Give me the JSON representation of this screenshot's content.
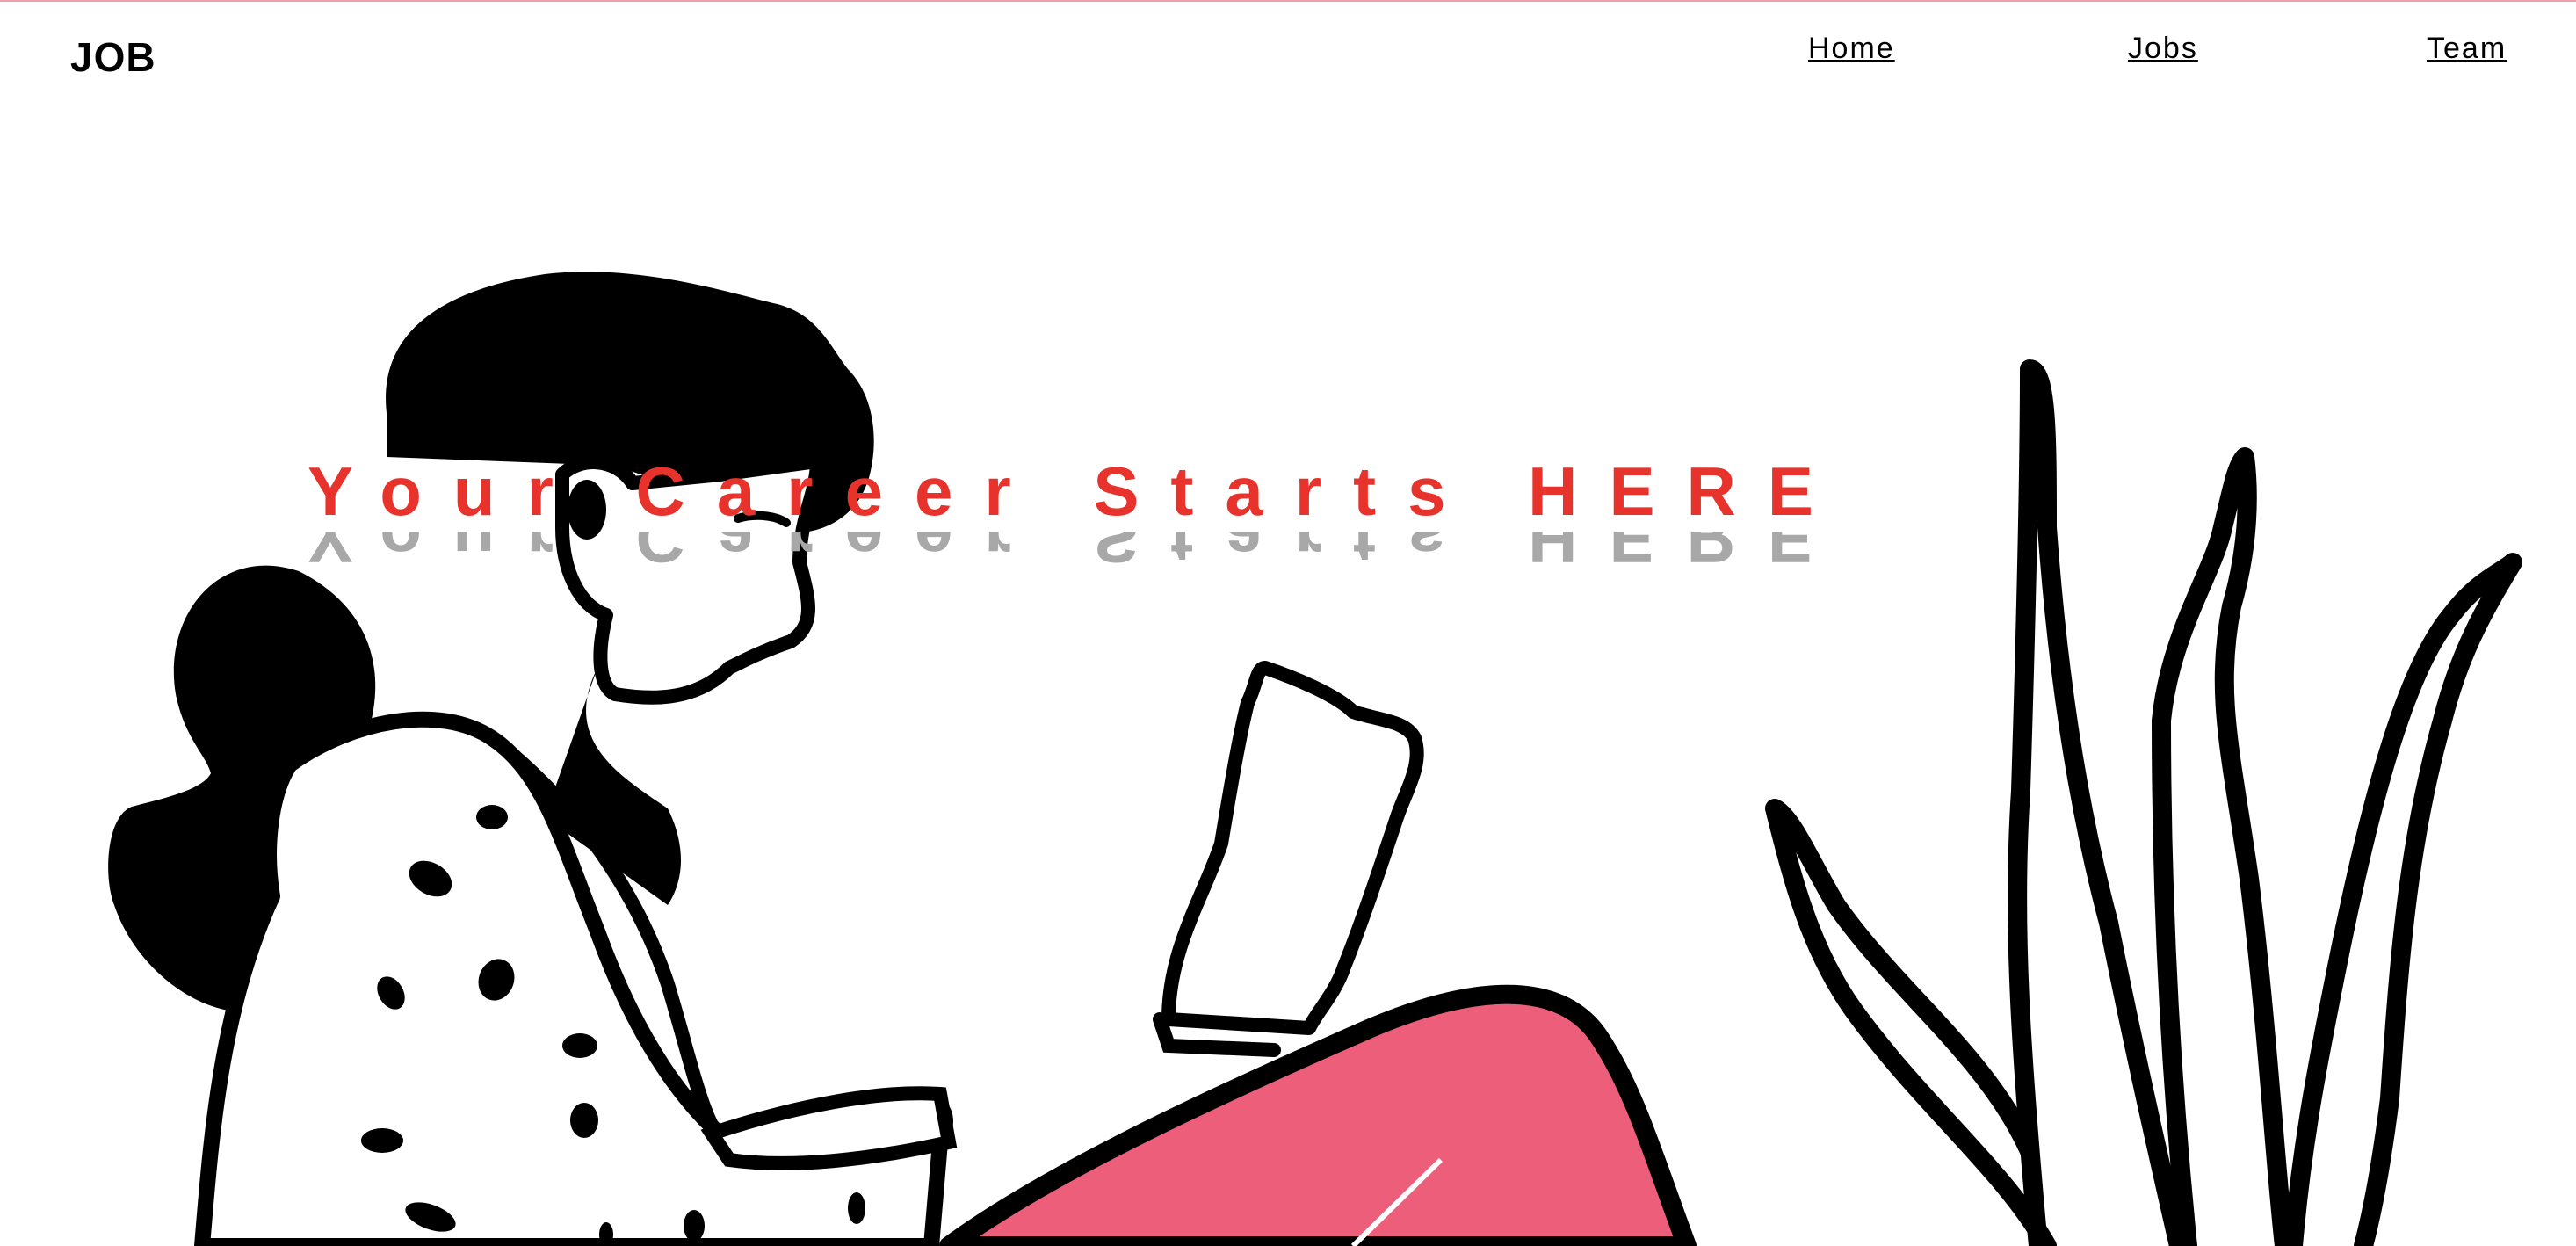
{
  "brand": {
    "logo": "JOB"
  },
  "nav": {
    "items": [
      "Home",
      "Jobs",
      "Team"
    ]
  },
  "hero": {
    "headline": "Your Career Starts HERE"
  },
  "colors": {
    "accent_red": "#e8332c",
    "reflection_gray": "#a8a8a8",
    "pants_pink": "#ec5e79",
    "ink": "#000000",
    "top_rule": "#e8a0aa"
  },
  "illustration": {
    "subject_icon": "woman-reading-book-icon",
    "plant_icon": "plant-leaves-icon"
  }
}
